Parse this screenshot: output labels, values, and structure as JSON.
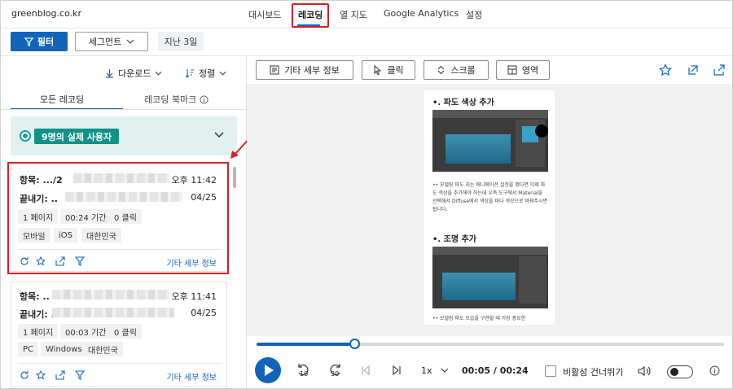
{
  "site": "greenblog.co.kr",
  "nav": [
    {
      "label": "대시보드",
      "active": false
    },
    {
      "label": "레코딩",
      "active": true
    },
    {
      "label": "열 지도",
      "active": false
    },
    {
      "label": "Google Analytics",
      "active": false
    },
    {
      "label": "설정",
      "active": false
    }
  ],
  "filters": {
    "filter_label": "필터",
    "segment_label": "세그먼트",
    "date_label": "지난 3일"
  },
  "left": {
    "download_label": "다운로드",
    "sort_label": "정렬",
    "tab_all": "모든 레코딩",
    "tab_bookmark": "레코딩 북마크",
    "users_badge": "9명의 실제 사용자"
  },
  "cards": [
    {
      "entry_label": "항목: .../2",
      "exit_label": "끝내기: ..",
      "time": "오후 11:42",
      "date": "04/25",
      "chips1": [
        "1 페이지",
        "00:24 기간",
        "0 클릭"
      ],
      "chips2": [
        "모바일",
        "iOS",
        "대한민국"
      ],
      "more": "기타 세부 정보"
    },
    {
      "entry_label": "항목: ..",
      "exit_label": "끝내기: ..",
      "time": "오후 11:41",
      "date": "04/25",
      "chips1": [
        "1 페이지",
        "00:03 기간",
        "0 클릭"
      ],
      "chips2": [
        "PC",
        "Windows",
        "대한민국"
      ],
      "more": "기타 세부 정보"
    }
  ],
  "right": {
    "details_label": "기타 세부 정보",
    "click_label": "클릭",
    "scroll_label": "스크롤",
    "area_label": "영역",
    "page_heading1": "•. 파도 색상 추가",
    "page_para1": "•• 모델링 파도 지는 애니메이션 설정을 했다면 이제 파도 색상을 추가해야 하는데 우측 도구에서 Material을 선택해서 Diffuse에서 색상을 바다 색상으로 바꿔주시면 됩니다.",
    "page_heading2": "•. 조명 추가",
    "page_para2": "•• 모델링 파도 모습을 구현할 때 가장 중요한",
    "progress": 0.2083,
    "skip_back": "10",
    "skip_fwd": "30",
    "speed": "1x",
    "time": "00:05 / 00:24",
    "skip_inactive": "비활성 건너뛰기"
  },
  "colors": {
    "accent": "#1264b8",
    "teal": "#119187",
    "highlight": "#d61f26"
  }
}
